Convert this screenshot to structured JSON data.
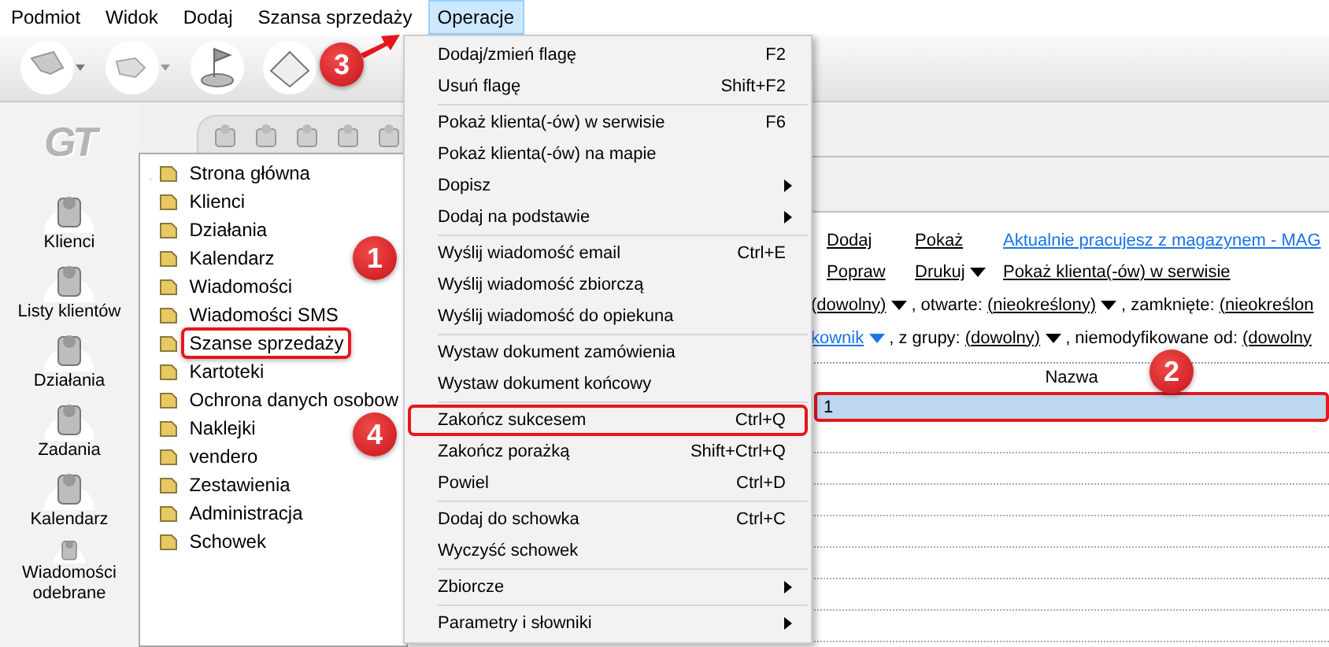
{
  "menubar": [
    {
      "label": "Podmiot",
      "selected": false
    },
    {
      "label": "Widok",
      "selected": false
    },
    {
      "label": "Dodaj",
      "selected": false
    },
    {
      "label": "Szansa sprzedaży",
      "selected": false
    },
    {
      "label": "Operacje",
      "selected": true
    }
  ],
  "logo": "GT",
  "nav": [
    {
      "label": "Klienci"
    },
    {
      "label": "Listy klientów"
    },
    {
      "label": "Działania"
    },
    {
      "label": "Zadania"
    },
    {
      "label": "Kalendarz"
    },
    {
      "label": "Wiadomości odebrane"
    }
  ],
  "tree": [
    {
      "label": "Strona główna",
      "highlighted": false
    },
    {
      "label": "Klienci",
      "highlighted": false
    },
    {
      "label": "Działania",
      "highlighted": false
    },
    {
      "label": "Kalendarz",
      "highlighted": false
    },
    {
      "label": "Wiadomości",
      "highlighted": false
    },
    {
      "label": "Wiadomości SMS",
      "highlighted": false
    },
    {
      "label": "Szanse sprzedaży",
      "highlighted": true
    },
    {
      "label": "Kartoteki",
      "highlighted": false
    },
    {
      "label": "Ochrona danych osobow",
      "highlighted": false
    },
    {
      "label": "Naklejki",
      "highlighted": false
    },
    {
      "label": "vendero",
      "highlighted": false
    },
    {
      "label": "Zestawienia",
      "highlighted": false
    },
    {
      "label": "Administracja",
      "highlighted": false
    },
    {
      "label": "Schowek",
      "highlighted": false
    }
  ],
  "menu": {
    "groups": [
      [
        {
          "label": "Dodaj/zmień flagę",
          "shortcut": "F2",
          "submenu": false,
          "highlighted": false
        },
        {
          "label": "Usuń flagę",
          "shortcut": "Shift+F2",
          "submenu": false,
          "highlighted": false
        }
      ],
      [
        {
          "label": "Pokaż klienta(-ów) w serwisie",
          "shortcut": "F6",
          "submenu": false,
          "highlighted": false
        },
        {
          "label": "Pokaż klienta(-ów) na mapie",
          "submenu": false,
          "highlighted": false
        },
        {
          "label": "Dopisz",
          "submenu": true,
          "highlighted": false
        },
        {
          "label": "Dodaj na podstawie",
          "submenu": true,
          "highlighted": false
        }
      ],
      [
        {
          "label": "Wyślij wiadomość email",
          "shortcut": "Ctrl+E",
          "submenu": false,
          "highlighted": false
        },
        {
          "label": "Wyślij wiadomość zbiorczą",
          "submenu": false,
          "highlighted": false
        },
        {
          "label": "Wyślij wiadomość do opiekuna",
          "submenu": false,
          "highlighted": false
        }
      ],
      [
        {
          "label": "Wystaw dokument zamówienia",
          "submenu": false,
          "highlighted": false
        },
        {
          "label": "Wystaw dokument końcowy",
          "submenu": false,
          "highlighted": false
        }
      ],
      [
        {
          "label": "Zakończ sukcesem",
          "shortcut": "Ctrl+Q",
          "submenu": false,
          "highlighted": true
        },
        {
          "label": "Zakończ porażką",
          "shortcut": "Shift+Ctrl+Q",
          "submenu": false,
          "highlighted": false
        },
        {
          "label": "Powiel",
          "shortcut": "Ctrl+D",
          "submenu": false,
          "highlighted": false
        }
      ],
      [
        {
          "label": "Dodaj do schowka",
          "shortcut": "Ctrl+C",
          "submenu": false,
          "highlighted": false
        },
        {
          "label": "Wyczyść schowek",
          "submenu": false,
          "highlighted": false
        }
      ],
      [
        {
          "label": "Zbiorcze",
          "submenu": true,
          "highlighted": false
        }
      ],
      [
        {
          "label": "Parametry i słowniki",
          "submenu": true,
          "highlighted": false
        }
      ]
    ]
  },
  "actions": [
    [
      {
        "label": "Dodaj",
        "kind": "action",
        "dropdown": false
      },
      {
        "label": "Pokaż",
        "kind": "action",
        "dropdown": false
      },
      {
        "label": "Aktualnie pracujesz z magazynem - MAG",
        "kind": "status"
      }
    ],
    [
      {
        "label": "Popraw",
        "kind": "action",
        "dropdown": false
      },
      {
        "label": "Drukuj",
        "kind": "action",
        "dropdown": true
      },
      {
        "label": "Pokaż klienta(-ów) w serwisie",
        "kind": "action",
        "dropdown": false
      }
    ]
  ],
  "filters": [
    [
      {
        "text": "(dowolny)",
        "kind": "value",
        "dropdown": true
      },
      {
        "text": ", otwarte:",
        "kind": "label"
      },
      {
        "text": "(nieokreślony)",
        "kind": "value",
        "dropdown": true
      },
      {
        "text": ", zamknięte:",
        "kind": "label"
      },
      {
        "text": "(nieokreślon",
        "kind": "value",
        "dropdown": false
      }
    ],
    [
      {
        "text": "kownik",
        "kind": "link",
        "dropdown": true
      },
      {
        "text": ", z grupy:",
        "kind": "label"
      },
      {
        "text": "(dowolny)",
        "kind": "value",
        "dropdown": true
      },
      {
        "text": ", niemodyfikowane od:",
        "kind": "label"
      },
      {
        "text": "(dowolny",
        "kind": "value",
        "dropdown": false
      }
    ]
  ],
  "table": {
    "columns": [
      "Nazwa"
    ],
    "rows": [
      {
        "cells": [
          "1"
        ],
        "selected": true,
        "highlighted": true
      }
    ]
  },
  "annotations": [
    {
      "number": "3",
      "arrow": true
    },
    {
      "number": "1",
      "arrow": false
    },
    {
      "number": "2",
      "arrow": false
    },
    {
      "number": "4",
      "arrow": false
    }
  ]
}
